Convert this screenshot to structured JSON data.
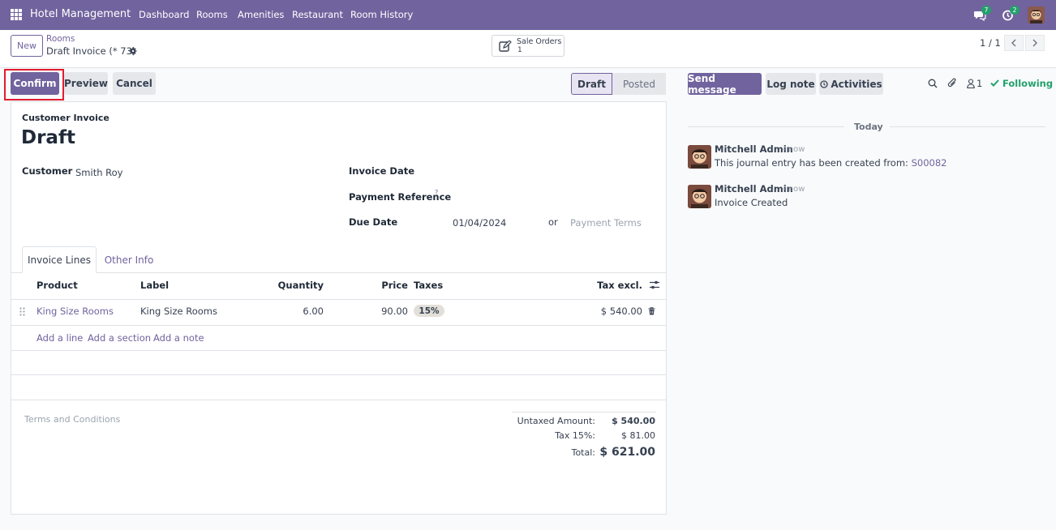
{
  "app": {
    "brand": "Hotel Management",
    "nav": [
      "Dashboard",
      "Rooms",
      "Amenities",
      "Restaurant",
      "Room History"
    ],
    "messages_badge": "7",
    "activities_badge": "2",
    "accent_color": "#71639e"
  },
  "control": {
    "new_label": "New",
    "breadcrumb_parent": "Rooms",
    "breadcrumb_current": "Draft Invoice (* 73)",
    "smart_button": {
      "label": "Sale Orders",
      "count": "1"
    },
    "pager": "1 / 1"
  },
  "actions": {
    "confirm": "Confirm",
    "preview": "Preview",
    "cancel": "Cancel"
  },
  "statusbar": {
    "draft": "Draft",
    "posted": "Posted"
  },
  "form": {
    "doc_type": "Customer Invoice",
    "title": "Draft",
    "customer_label": "Customer",
    "customer_value": "Smith Roy",
    "invoice_date_label": "Invoice Date",
    "invoice_date_value": "",
    "payment_ref_label": "Payment Reference",
    "payment_ref_help": "?",
    "due_date_label": "Due Date",
    "due_date_value": "01/04/2024",
    "or_label": "or",
    "payment_terms_placeholder": "Payment Terms"
  },
  "tabs": [
    "Invoice Lines",
    "Other Info"
  ],
  "lines": {
    "headers": {
      "product": "Product",
      "label": "Label",
      "quantity": "Quantity",
      "price": "Price",
      "taxes": "Taxes",
      "tax_excl": "Tax excl."
    },
    "rows": [
      {
        "product": "King Size Rooms",
        "label": "King Size Rooms",
        "quantity": "6.00",
        "price": "90.00",
        "tax": "15%",
        "subtotal": "$ 540.00"
      }
    ],
    "add_line": "Add a line",
    "add_section": "Add a section",
    "add_note": "Add a note"
  },
  "terms_placeholder": "Terms and Conditions",
  "totals": {
    "untaxed_label": "Untaxed Amount:",
    "untaxed_value": "$ 540.00",
    "tax_label": "Tax 15%:",
    "tax_value": "$ 81.00",
    "total_label": "Total:",
    "total_value": "$ 621.00"
  },
  "chatter": {
    "send_message": "Send message",
    "log_note": "Log note",
    "activities": "Activities",
    "followers_count": "1",
    "following": "Following",
    "date_separator": "Today",
    "messages": [
      {
        "author": "Mitchell Admin",
        "when": "- now",
        "body": "This journal entry has been created from:",
        "link": "S00082"
      },
      {
        "author": "Mitchell Admin",
        "when": "- now",
        "body": "Invoice Created",
        "link": ""
      }
    ]
  }
}
